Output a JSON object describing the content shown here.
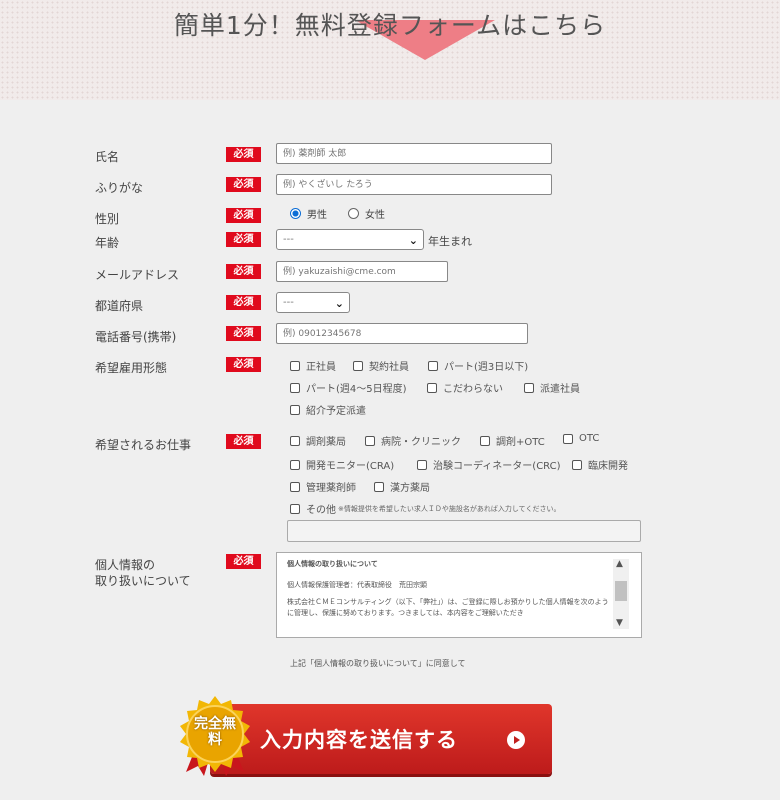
{
  "header": {
    "title": "簡単1分！無料登録フォームはこちら"
  },
  "required_label": "必須",
  "fields": {
    "name": {
      "label": "氏名",
      "placeholder": "例) 薬剤師 太郎"
    },
    "furigana": {
      "label": "ふりがな",
      "placeholder": "例) やくざいし たろう"
    },
    "gender": {
      "label": "性別",
      "options": [
        "男性",
        "女性"
      ],
      "selected": "男性"
    },
    "birth_year": {
      "label": "年齢",
      "value": "---",
      "suffix": "年生まれ"
    },
    "email": {
      "label": "メールアドレス",
      "placeholder": "例) yakuzaishi@cme.com"
    },
    "prefecture": {
      "label": "都道府県",
      "value": "---"
    },
    "phone": {
      "label": "電話番号(携帯)",
      "placeholder": "例) 09012345678"
    },
    "employment": {
      "label": "希望雇用形態",
      "options": [
        "正社員",
        "契約社員",
        "パート(週3日以下)",
        "パート(週4～5日程度)",
        "こだわらない",
        "派遣社員",
        "紹介予定派遣"
      ]
    },
    "job": {
      "label": "希望されるお仕事",
      "options": [
        "調剤薬局",
        "病院・クリニック",
        "調剤+OTC",
        "OTC",
        "開発モニター(CRA)",
        "治験コーディネーター(CRC)",
        "臨床開発",
        "管理薬剤師",
        "漢方薬局"
      ],
      "other_label": "その他",
      "other_note": "※情報提供を希望したい求人ＩＤや施設名があれば入力してください。"
    },
    "privacy": {
      "label_line1": "個人情報の",
      "label_line2": "取り扱いについて",
      "box_title": "個人情報の取り扱いについて",
      "box_line1": "個人情報保護管理者：代表取締役　荒田宗顕",
      "box_line2": "株式会社ＣＭＥコンサルティング（以下、「弊社」）は、ご登録に際しお預かりした個人情報を次のように管理し、保護に努めております。つきましては、本内容をご理解いただき"
    }
  },
  "agree_text": "上記「個人情報の取り扱いについて」に同意して",
  "submit": {
    "label": "入力内容を送信する",
    "badge": "完全無料"
  },
  "colors": {
    "required": "#e00a1d",
    "button": "#cc2424",
    "badge": "#f2b705"
  }
}
